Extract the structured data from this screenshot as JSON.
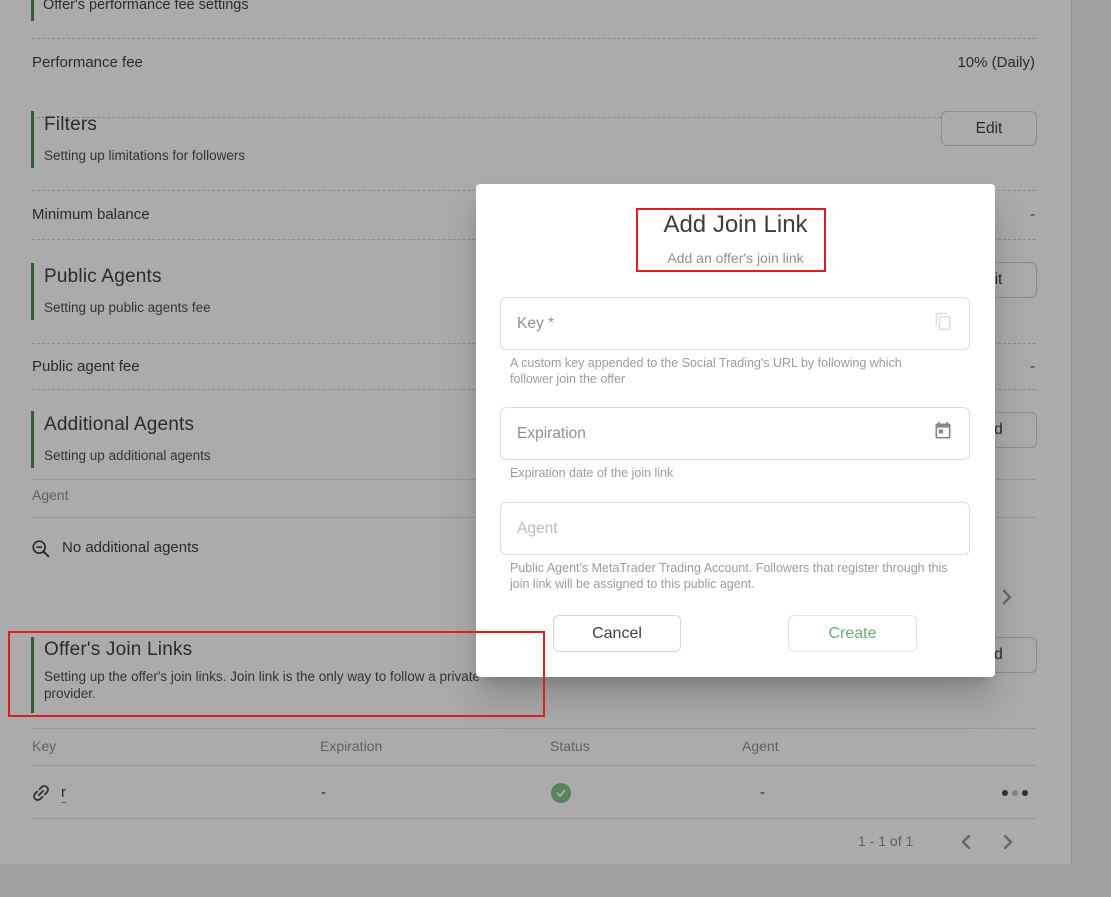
{
  "colors": {
    "accent_green": "#43914a",
    "status_green": "#82c785",
    "create_green": "#6cae70",
    "annotation_red": "#e01d1d"
  },
  "page": {
    "top_section": {
      "subtitle": "Offer's performance fee settings"
    },
    "rows": {
      "performance_fee": {
        "label": "Performance fee",
        "value": "10% (Daily)"
      },
      "minimum_balance": {
        "label": "Minimum balance",
        "value": "-"
      },
      "public_agent_fee": {
        "label": "Public agent fee",
        "value": "-"
      }
    },
    "sections": {
      "filters": {
        "title": "Filters",
        "subtitle": "Setting up limitations for followers",
        "action": "Edit"
      },
      "public_agents": {
        "title": "Public Agents",
        "subtitle": "Setting up public agents fee",
        "action": "Edit"
      },
      "additional_agents": {
        "title": "Additional Agents",
        "subtitle": "Setting up additional agents",
        "action": "Add"
      },
      "join_links": {
        "title": "Offer's Join Links",
        "subtitle": "Setting up the offer's join links. Join link is the only way to follow a private provider.",
        "action": "Add"
      }
    },
    "additional_agents_table": {
      "header": "Agent",
      "empty_text": "No additional agents"
    },
    "join_links_table": {
      "headers": {
        "key": "Key",
        "expiration": "Expiration",
        "status": "Status",
        "agent": "Agent"
      },
      "row": {
        "key": "r",
        "expiration": "-",
        "status": "active",
        "agent": "-"
      },
      "pagination": "1 - 1 of 1"
    }
  },
  "modal": {
    "title": "Add Join Link",
    "subtitle": "Add an offer's join link",
    "fields": {
      "key": {
        "label": "Key *",
        "helper": "A custom key appended to the Social Trading's URL by following which follower join the offer"
      },
      "expiration": {
        "label": "Expiration",
        "helper": "Expiration date of the join link"
      },
      "agent": {
        "placeholder": "Agent",
        "helper": "Public Agent's MetaTrader Trading Account. Followers that register through this join link will be assigned to this public agent."
      }
    },
    "buttons": {
      "cancel": "Cancel",
      "create": "Create"
    }
  }
}
